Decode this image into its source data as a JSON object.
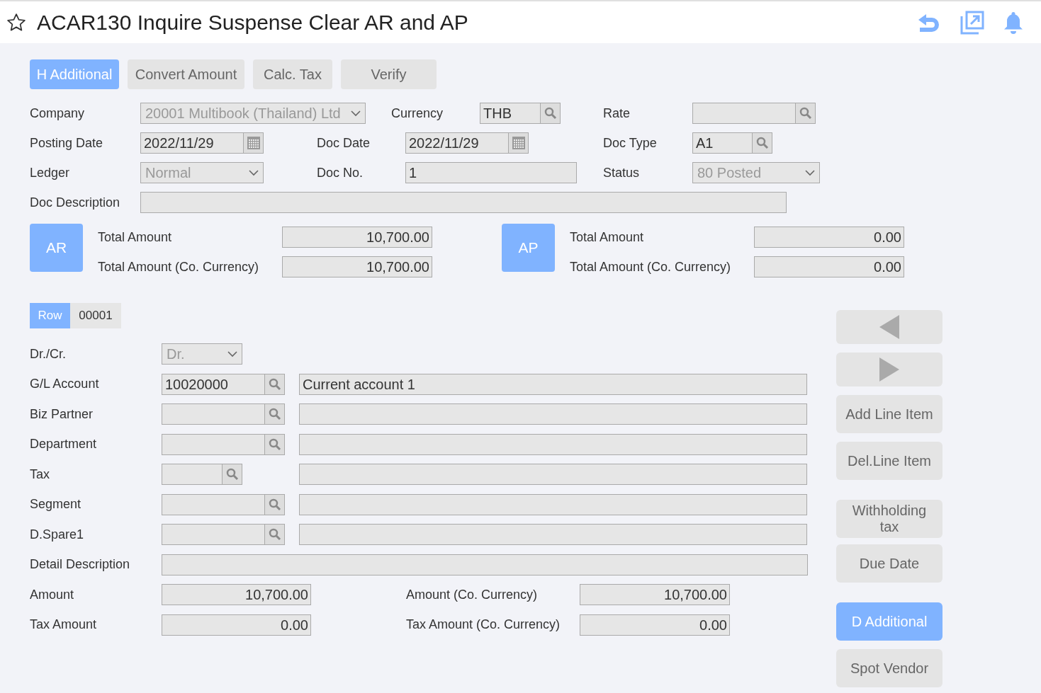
{
  "title": "ACAR130 Inquire Suspense Clear AR and AP",
  "toolbar_buttons": [
    {
      "label": "H Additional",
      "selected": true
    },
    {
      "label": "Convert Amount",
      "selected": false
    },
    {
      "label": "Calc. Tax",
      "selected": false
    },
    {
      "label": "Verify",
      "selected": false
    }
  ],
  "header_rows": [
    [
      {
        "label": "Company",
        "kind": "select",
        "value": "20001 Multibook (Thailand) Ltd",
        "disabled": true
      },
      {
        "label": "Currency",
        "kind": "lookup",
        "value": "THB"
      },
      {
        "label": "Rate",
        "kind": "lookup"
      }
    ],
    [
      {
        "label": "Posting Date",
        "kind": "date",
        "value": "2022/11/29"
      },
      {
        "label": "Doc Date",
        "kind": "date",
        "value": "2022/11/29"
      },
      {
        "label": "Doc Type",
        "kind": "lookup",
        "value": "A1"
      }
    ],
    [
      {
        "label": "Ledger",
        "kind": "select",
        "value": "Normal",
        "disabled": true
      },
      {
        "label": "Doc No.",
        "kind": "text",
        "value": "1"
      },
      {
        "label": "Status",
        "kind": "select",
        "value": "80 Posted",
        "disabled": true
      }
    ],
    [
      {
        "label": "Doc Description",
        "kind": "text"
      }
    ]
  ],
  "totals": [
    {
      "badge": "AR",
      "rows": [
        {
          "label": "Total Amount",
          "value": "10,700.00"
        },
        {
          "label": "Total Amount (Co. Currency)",
          "value": "10,700.00"
        }
      ]
    },
    {
      "badge": "AP",
      "rows": [
        {
          "label": "Total Amount",
          "value": "0.00"
        },
        {
          "label": "Total Amount (Co. Currency)",
          "value": "0.00"
        }
      ]
    }
  ],
  "row_indicator": {
    "label": "Row",
    "value": "00001"
  },
  "detail_rows": [
    {
      "kind": "select",
      "label": "Dr./Cr.",
      "value": "Dr.",
      "disabled": true
    },
    {
      "kind": "lookup",
      "label": "G/L Account",
      "value": "10020000",
      "description": "Current account 1"
    },
    {
      "kind": "lookup",
      "label": "Biz Partner"
    },
    {
      "kind": "lookup",
      "label": "Department"
    },
    {
      "kind": "lookup_short",
      "label": "Tax"
    },
    {
      "kind": "lookup",
      "label": "Segment"
    },
    {
      "kind": "lookup",
      "label": "D.Spare1"
    },
    {
      "kind": "text",
      "label": "Detail Description"
    },
    {
      "kind": "amount",
      "label": "Amount",
      "value": "10,700.00",
      "label_2": "Amount (Co. Currency)",
      "value_2": "10,700.00"
    },
    {
      "kind": "amount",
      "label": "Tax Amount",
      "value": "0.00",
      "label_2": "Tax Amount (Co. Currency)",
      "value_2": "0.00"
    }
  ],
  "side_buttons": [
    {
      "kind": "prev",
      "selected": false
    },
    {
      "kind": "next",
      "selected": false
    },
    {
      "kind": "text",
      "label": "Add Line Item",
      "selected": false
    },
    {
      "kind": "text",
      "label": "Del.Line Item",
      "selected": false
    },
    {
      "kind": "text",
      "label": "Withholding tax",
      "selected": false
    },
    {
      "kind": "text",
      "label": "Due Date",
      "selected": false
    },
    {
      "kind": "text",
      "label": "D Additional",
      "selected": true
    },
    {
      "kind": "text",
      "label": "Spot Vendor",
      "selected": false
    }
  ]
}
